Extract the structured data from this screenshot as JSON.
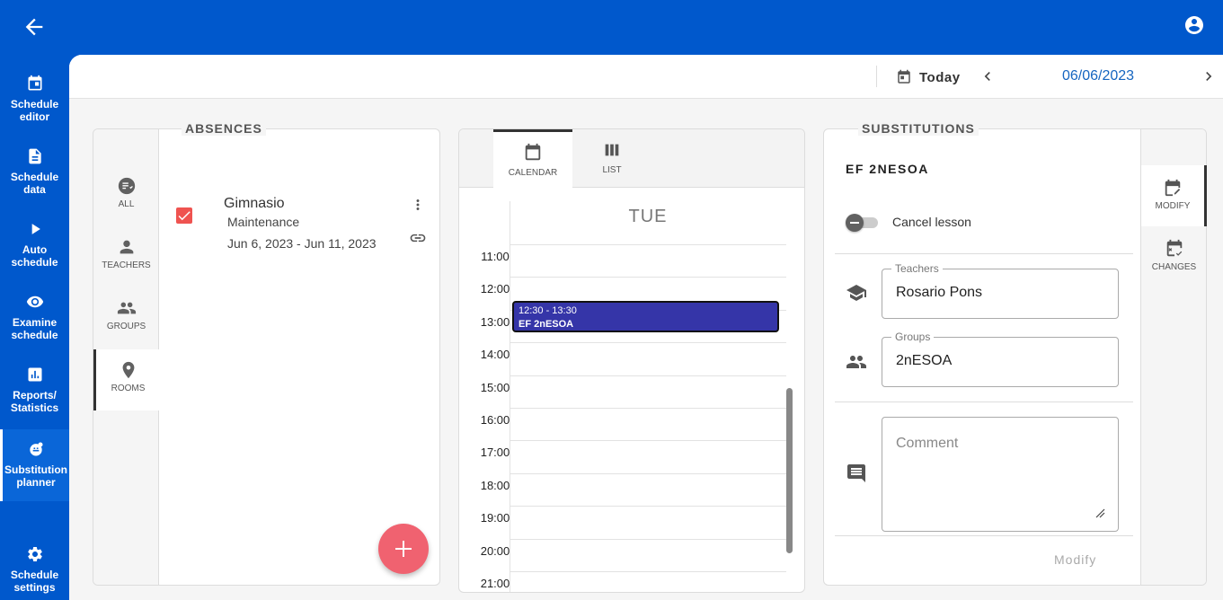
{
  "nav": {
    "items": [
      {
        "label": "Schedule editor",
        "icon": "calendar-icon"
      },
      {
        "label": "Schedule data",
        "icon": "document-icon"
      },
      {
        "label": "Auto schedule",
        "icon": "play-icon"
      },
      {
        "label": "Examine schedule",
        "icon": "eye-icon"
      },
      {
        "label": "Reports/ Statistics",
        "icon": "chart-icon"
      },
      {
        "label": "Substitution planner",
        "icon": "substitution-icon"
      },
      {
        "label": "Schedule settings",
        "icon": "gear-icon"
      }
    ],
    "active_index": 5
  },
  "datebar": {
    "today_label": "Today",
    "date": "06/06/2023"
  },
  "absences": {
    "title": "ABSENCES",
    "tabs": [
      "ALL",
      "TEACHERS",
      "GROUPS",
      "ROOMS"
    ],
    "active_tab": "ROOMS",
    "item": {
      "name": "Gimnasio",
      "reason": "Maintenance",
      "dates": "Jun 6, 2023 - Jun 11, 2023",
      "checked": true
    },
    "fab_symbol": "+"
  },
  "calendar": {
    "tabs": [
      "CALENDAR",
      "LIST"
    ],
    "active_tab": "CALENDAR",
    "day": "TUE",
    "hours": [
      "11:00",
      "12:00",
      "13:00",
      "14:00",
      "15:00",
      "16:00",
      "17:00",
      "18:00",
      "19:00",
      "20:00",
      "21:00"
    ],
    "event": {
      "time": "12:30 - 13:30",
      "title": "EF 2nESOA",
      "color": "#3535a8"
    }
  },
  "substitutions": {
    "title": "SUBSTITUTIONS",
    "lesson": "EF 2NESOA",
    "cancel_label": "Cancel lesson",
    "teachers_label": "Teachers",
    "teachers_value": "Rosario Pons",
    "groups_label": "Groups",
    "groups_value": "2nESOA",
    "comment_placeholder": "Comment",
    "modify_button": "Modify",
    "tabs": [
      "MODIFY",
      "CHANGES"
    ],
    "active_tab": "MODIFY"
  },
  "colors": {
    "primary": "#0058cc",
    "accent": "#f06270",
    "link": "#1565c0"
  }
}
